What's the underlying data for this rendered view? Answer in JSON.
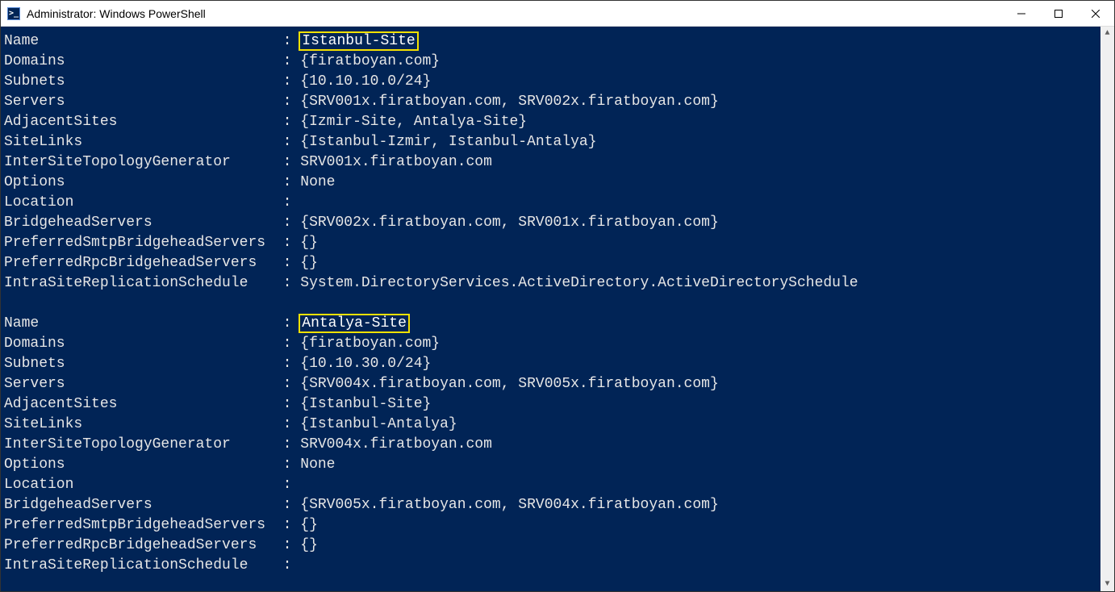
{
  "window": {
    "title": "Administrator: Windows PowerShell"
  },
  "records": [
    {
      "highlight_name": true,
      "fields": [
        {
          "label": "Name",
          "value": "Istanbul-Site"
        },
        {
          "label": "Domains",
          "value": "{firatboyan.com}"
        },
        {
          "label": "Subnets",
          "value": "{10.10.10.0/24}"
        },
        {
          "label": "Servers",
          "value": "{SRV001x.firatboyan.com, SRV002x.firatboyan.com}"
        },
        {
          "label": "AdjacentSites",
          "value": "{Izmir-Site, Antalya-Site}"
        },
        {
          "label": "SiteLinks",
          "value": "{Istanbul-Izmir, Istanbul-Antalya}"
        },
        {
          "label": "InterSiteTopologyGenerator",
          "value": "SRV001x.firatboyan.com"
        },
        {
          "label": "Options",
          "value": "None"
        },
        {
          "label": "Location",
          "value": ""
        },
        {
          "label": "BridgeheadServers",
          "value": "{SRV002x.firatboyan.com, SRV001x.firatboyan.com}"
        },
        {
          "label": "PreferredSmtpBridgeheadServers",
          "value": "{}"
        },
        {
          "label": "PreferredRpcBridgeheadServers",
          "value": "{}"
        },
        {
          "label": "IntraSiteReplicationSchedule",
          "value": "System.DirectoryServices.ActiveDirectory.ActiveDirectorySchedule"
        }
      ]
    },
    {
      "highlight_name": true,
      "fields": [
        {
          "label": "Name",
          "value": "Antalya-Site"
        },
        {
          "label": "Domains",
          "value": "{firatboyan.com}"
        },
        {
          "label": "Subnets",
          "value": "{10.10.30.0/24}"
        },
        {
          "label": "Servers",
          "value": "{SRV004x.firatboyan.com, SRV005x.firatboyan.com}"
        },
        {
          "label": "AdjacentSites",
          "value": "{Istanbul-Site}"
        },
        {
          "label": "SiteLinks",
          "value": "{Istanbul-Antalya}"
        },
        {
          "label": "InterSiteTopologyGenerator",
          "value": "SRV004x.firatboyan.com"
        },
        {
          "label": "Options",
          "value": "None"
        },
        {
          "label": "Location",
          "value": ""
        },
        {
          "label": "BridgeheadServers",
          "value": "{SRV005x.firatboyan.com, SRV004x.firatboyan.com}"
        },
        {
          "label": "PreferredSmtpBridgeheadServers",
          "value": "{}"
        },
        {
          "label": "PreferredRpcBridgeheadServers",
          "value": "{}"
        },
        {
          "label": "IntraSiteReplicationSchedule",
          "value": ""
        }
      ]
    }
  ],
  "separator": ":"
}
